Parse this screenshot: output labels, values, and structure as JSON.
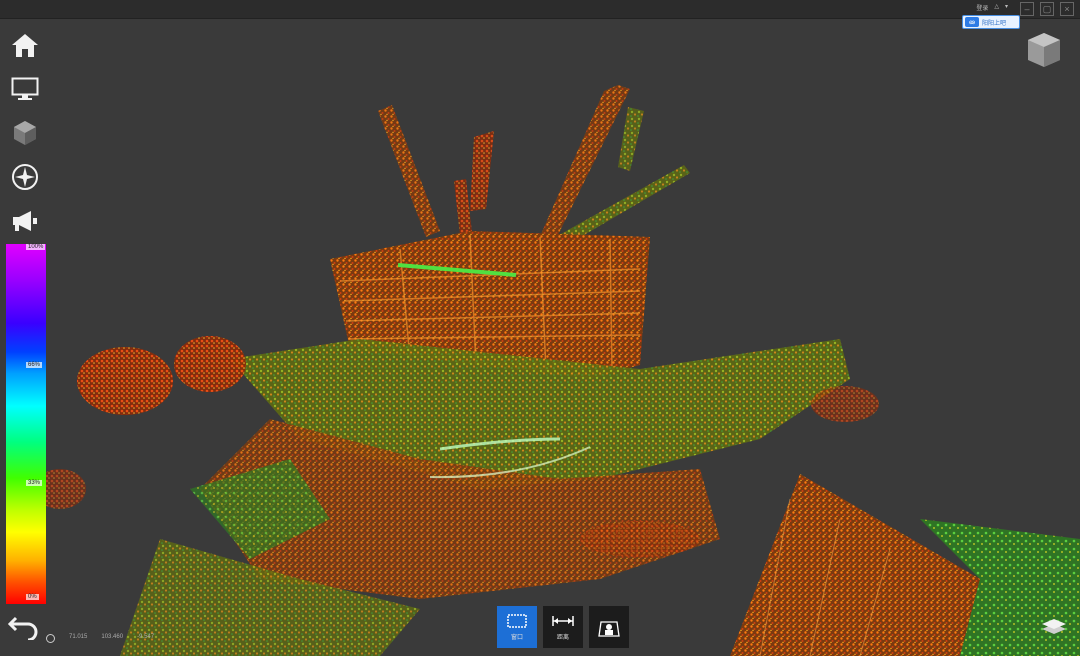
{
  "window": {
    "top_labels": [
      "登录",
      "△",
      "▾"
    ]
  },
  "login": {
    "label": "阳阳上吧"
  },
  "left_toolbar": {
    "items": [
      "home-icon",
      "monitor-icon",
      "cube-icon",
      "compass-icon",
      "megaphone-icon"
    ]
  },
  "legend": {
    "labels": [
      "100%",
      "66%",
      "33%",
      "0%"
    ]
  },
  "coords": {
    "x": "71.015",
    "y": "103.460",
    "z": "-9.547"
  },
  "bottom_toolbar": {
    "items": [
      {
        "icon": "rectangle-select-icon",
        "label": "窗口",
        "active": true
      },
      {
        "icon": "measure-distance-icon",
        "label": "距离",
        "active": false
      },
      {
        "icon": "section-box-icon",
        "label": "",
        "active": false
      }
    ]
  },
  "colors": {
    "accent": "#1d6fd6",
    "background": "#3a3a3a"
  }
}
